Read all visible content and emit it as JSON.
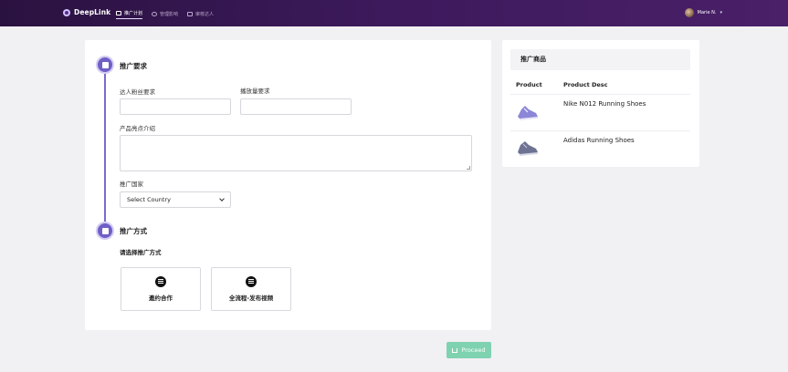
{
  "header": {
    "brand": "DeepLink",
    "nav": [
      {
        "label": "推广计划",
        "active": true
      },
      {
        "label": "管理影响",
        "active": false
      },
      {
        "label": "审核达人",
        "active": false
      }
    ],
    "user_name": "Marie N."
  },
  "form": {
    "section1_title": "推广要求",
    "followers_label": "达人粉丝要求",
    "followers_value": "",
    "views_label": "播放量要求",
    "views_value": "",
    "highlight_label": "产品亮点介绍",
    "highlight_value": "",
    "country_label": "推广国家",
    "country_selected": "Select Country",
    "section2_title": "推广方式",
    "method_prompt": "请选择推广方式",
    "options": [
      {
        "label": "邀约合作",
        "icon": "chat-icon"
      },
      {
        "label": "全流程-发布视频",
        "icon": "video-publish-icon"
      }
    ]
  },
  "proceed_label": "Proceed",
  "products": {
    "title": "推广商品",
    "col_product": "Product",
    "col_desc": "Product Desc",
    "items": [
      {
        "name": "Nike N012 Running Shoes",
        "icon": "purple-shoe"
      },
      {
        "name": "Adidas Running Shoes",
        "icon": "gray-shoe"
      }
    ]
  },
  "colors": {
    "topbar": "#3d1a5c",
    "accent": "#6f5fc6",
    "proceed": "#7fd2b0"
  }
}
